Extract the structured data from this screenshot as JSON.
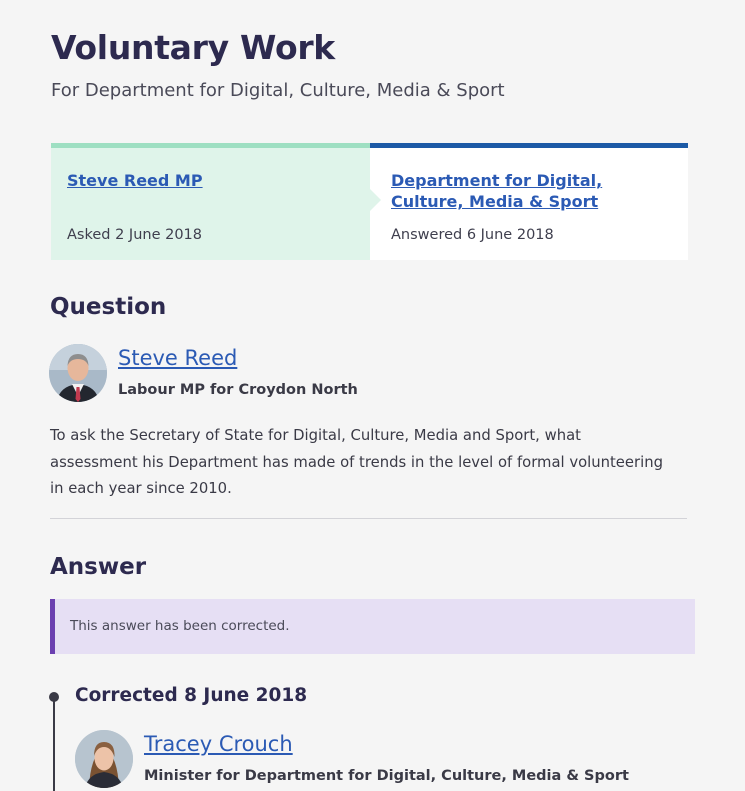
{
  "page": {
    "title": "Voluntary Work",
    "subtitle": "For Department for Digital, Culture, Media & Sport"
  },
  "asked": {
    "member_link": "Steve Reed MP",
    "date": "Asked 2 June 2018"
  },
  "answered": {
    "department_link": "Department for Digital, Culture, Media & Sport",
    "date": "Answered 6 June 2018"
  },
  "question": {
    "heading": "Question",
    "member_name": "Steve Reed",
    "member_role": "Labour MP for Croydon North",
    "text": "To ask the Secretary of State for Digital, Culture, Media and Sport, what assessment his Department has made of trends in the level of formal volunteering in each year since 2010."
  },
  "answer": {
    "heading": "Answer",
    "notice": "This answer has been corrected.",
    "corrected_label": "Corrected 8 June 2018",
    "member_name": "Tracey Crouch",
    "member_role": "Minister for Department for Digital, Culture, Media & Sport"
  },
  "colors": {
    "link": "#2b5ab4",
    "asked_bg": "#dff4ea",
    "asked_accent": "#9edfc2",
    "answered_accent": "#1c5aa6",
    "notice_bg": "#e6dff4",
    "notice_accent": "#6b3fb0"
  }
}
